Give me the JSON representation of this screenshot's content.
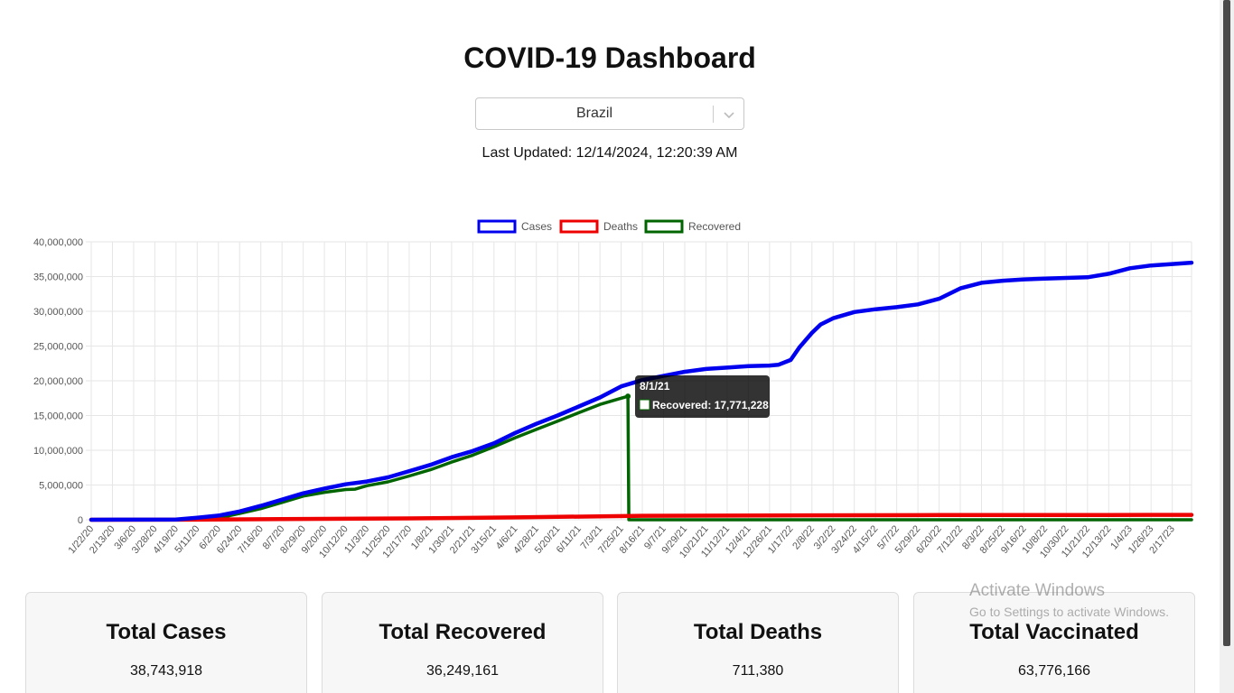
{
  "header": {
    "title": "COVID-19 Dashboard"
  },
  "country_select": {
    "value": "Brazil"
  },
  "last_updated": "Last Updated: 12/14/2024, 12:20:39 AM",
  "colors": {
    "cases": "#0000ee",
    "deaths": "#ee0000",
    "recovered": "#006400"
  },
  "chart_data": {
    "type": "line",
    "legend": [
      "Cases",
      "Deaths",
      "Recovered"
    ],
    "legend_position": "top",
    "grid": true,
    "ylim": [
      0,
      40000000
    ],
    "y_ticks": [
      "0",
      "5,000,000",
      "10,000,000",
      "15,000,000",
      "20,000,000",
      "25,000,000",
      "30,000,000",
      "35,000,000",
      "40,000,000"
    ],
    "x_ticks": [
      "1/22/20",
      "2/13/20",
      "3/6/20",
      "3/28/20",
      "4/19/20",
      "5/11/20",
      "6/2/20",
      "6/24/20",
      "7/16/20",
      "8/7/20",
      "8/29/20",
      "9/20/20",
      "10/12/20",
      "11/3/20",
      "11/25/20",
      "12/17/20",
      "1/8/21",
      "1/30/21",
      "2/21/21",
      "3/15/21",
      "4/6/21",
      "4/28/21",
      "5/20/21",
      "6/11/21",
      "7/3/21",
      "7/25/21",
      "8/16/21",
      "9/7/21",
      "9/29/21",
      "10/21/21",
      "11/12/21",
      "12/4/21",
      "12/26/21",
      "1/17/22",
      "2/8/22",
      "3/2/22",
      "3/24/22",
      "4/15/22",
      "5/7/22",
      "5/29/22",
      "6/20/22",
      "7/12/22",
      "8/3/22",
      "8/25/22",
      "9/16/22",
      "10/8/22",
      "10/30/22",
      "11/21/22",
      "12/13/22",
      "1/4/23",
      "1/26/23",
      "2/17/23"
    ],
    "series": [
      {
        "name": "Cases",
        "x": [
          "1/22/20",
          "4/19/20",
          "5/11/20",
          "6/2/20",
          "6/24/20",
          "7/16/20",
          "8/7/20",
          "8/29/20",
          "9/20/20",
          "10/12/20",
          "11/3/20",
          "11/25/20",
          "12/17/20",
          "1/8/21",
          "1/30/21",
          "2/21/21",
          "3/15/21",
          "4/6/21",
          "4/28/21",
          "5/20/21",
          "6/11/21",
          "7/3/21",
          "7/25/21",
          "8/16/21",
          "9/7/21",
          "9/29/21",
          "10/21/21",
          "11/12/21",
          "12/4/21",
          "12/26/21",
          "1/4/22",
          "1/17/22",
          "1/26/22",
          "2/8/22",
          "2/17/22",
          "3/2/22",
          "3/24/22",
          "4/15/22",
          "5/7/22",
          "5/29/22",
          "6/20/22",
          "7/12/22",
          "8/3/22",
          "8/25/22",
          "9/16/22",
          "10/8/22",
          "10/30/22",
          "11/21/22",
          "12/13/22",
          "1/4/23",
          "1/26/23",
          "2/17/23",
          "3/9/23"
        ],
        "values": [
          0,
          40000,
          300000,
          600000,
          1200000,
          2000000,
          2900000,
          3800000,
          4500000,
          5100000,
          5500000,
          6100000,
          7000000,
          7900000,
          9000000,
          9900000,
          11000000,
          12500000,
          13800000,
          15000000,
          16300000,
          17600000,
          19200000,
          20100000,
          20700000,
          21300000,
          21700000,
          21900000,
          22100000,
          22200000,
          22300000,
          23000000,
          24800000,
          26900000,
          28100000,
          29000000,
          29900000,
          30300000,
          30600000,
          31000000,
          31800000,
          33300000,
          34100000,
          34400000,
          34600000,
          34700000,
          34800000,
          34900000,
          35400000,
          36200000,
          36600000,
          36800000,
          37000000
        ]
      },
      {
        "name": "Deaths",
        "x": [
          "1/22/20",
          "5/11/20",
          "8/7/20",
          "12/17/20",
          "4/6/21",
          "8/16/21",
          "12/26/21",
          "6/20/22",
          "12/13/22",
          "3/9/23"
        ],
        "values": [
          0,
          10000,
          100000,
          190000,
          340000,
          570000,
          620000,
          670000,
          693000,
          699000
        ]
      },
      {
        "name": "Recovered",
        "x": [
          "1/22/20",
          "5/11/20",
          "6/2/20",
          "6/24/20",
          "7/16/20",
          "8/7/20",
          "8/29/20",
          "9/20/20",
          "10/12/20",
          "10/22/20",
          "11/3/20",
          "11/25/20",
          "12/17/20",
          "1/8/21",
          "1/30/21",
          "2/21/21",
          "3/15/21",
          "4/6/21",
          "4/28/21",
          "5/20/21",
          "6/11/21",
          "7/3/21",
          "7/25/21",
          "8/1/21",
          "8/2/21",
          "3/9/23"
        ],
        "values": [
          0,
          0,
          250000,
          900000,
          1600000,
          2500000,
          3400000,
          3950000,
          4350000,
          4400000,
          4900000,
          5450000,
          6300000,
          7200000,
          8300000,
          9300000,
          10500000,
          11800000,
          13000000,
          14200000,
          15400000,
          16600000,
          17500000,
          17771228,
          0,
          0
        ]
      }
    ],
    "tooltip": {
      "title": "8/1/21",
      "label": "Recovered: 17,771,228"
    }
  },
  "cards": [
    {
      "title": "Total Cases",
      "value": "38,743,918"
    },
    {
      "title": "Total Recovered",
      "value": "36,249,161"
    },
    {
      "title": "Total Deaths",
      "value": "711,380"
    },
    {
      "title": "Total Vaccinated",
      "value": "63,776,166"
    }
  ],
  "watermark": {
    "line1": "Activate Windows",
    "line2": "Go to Settings to activate Windows."
  }
}
